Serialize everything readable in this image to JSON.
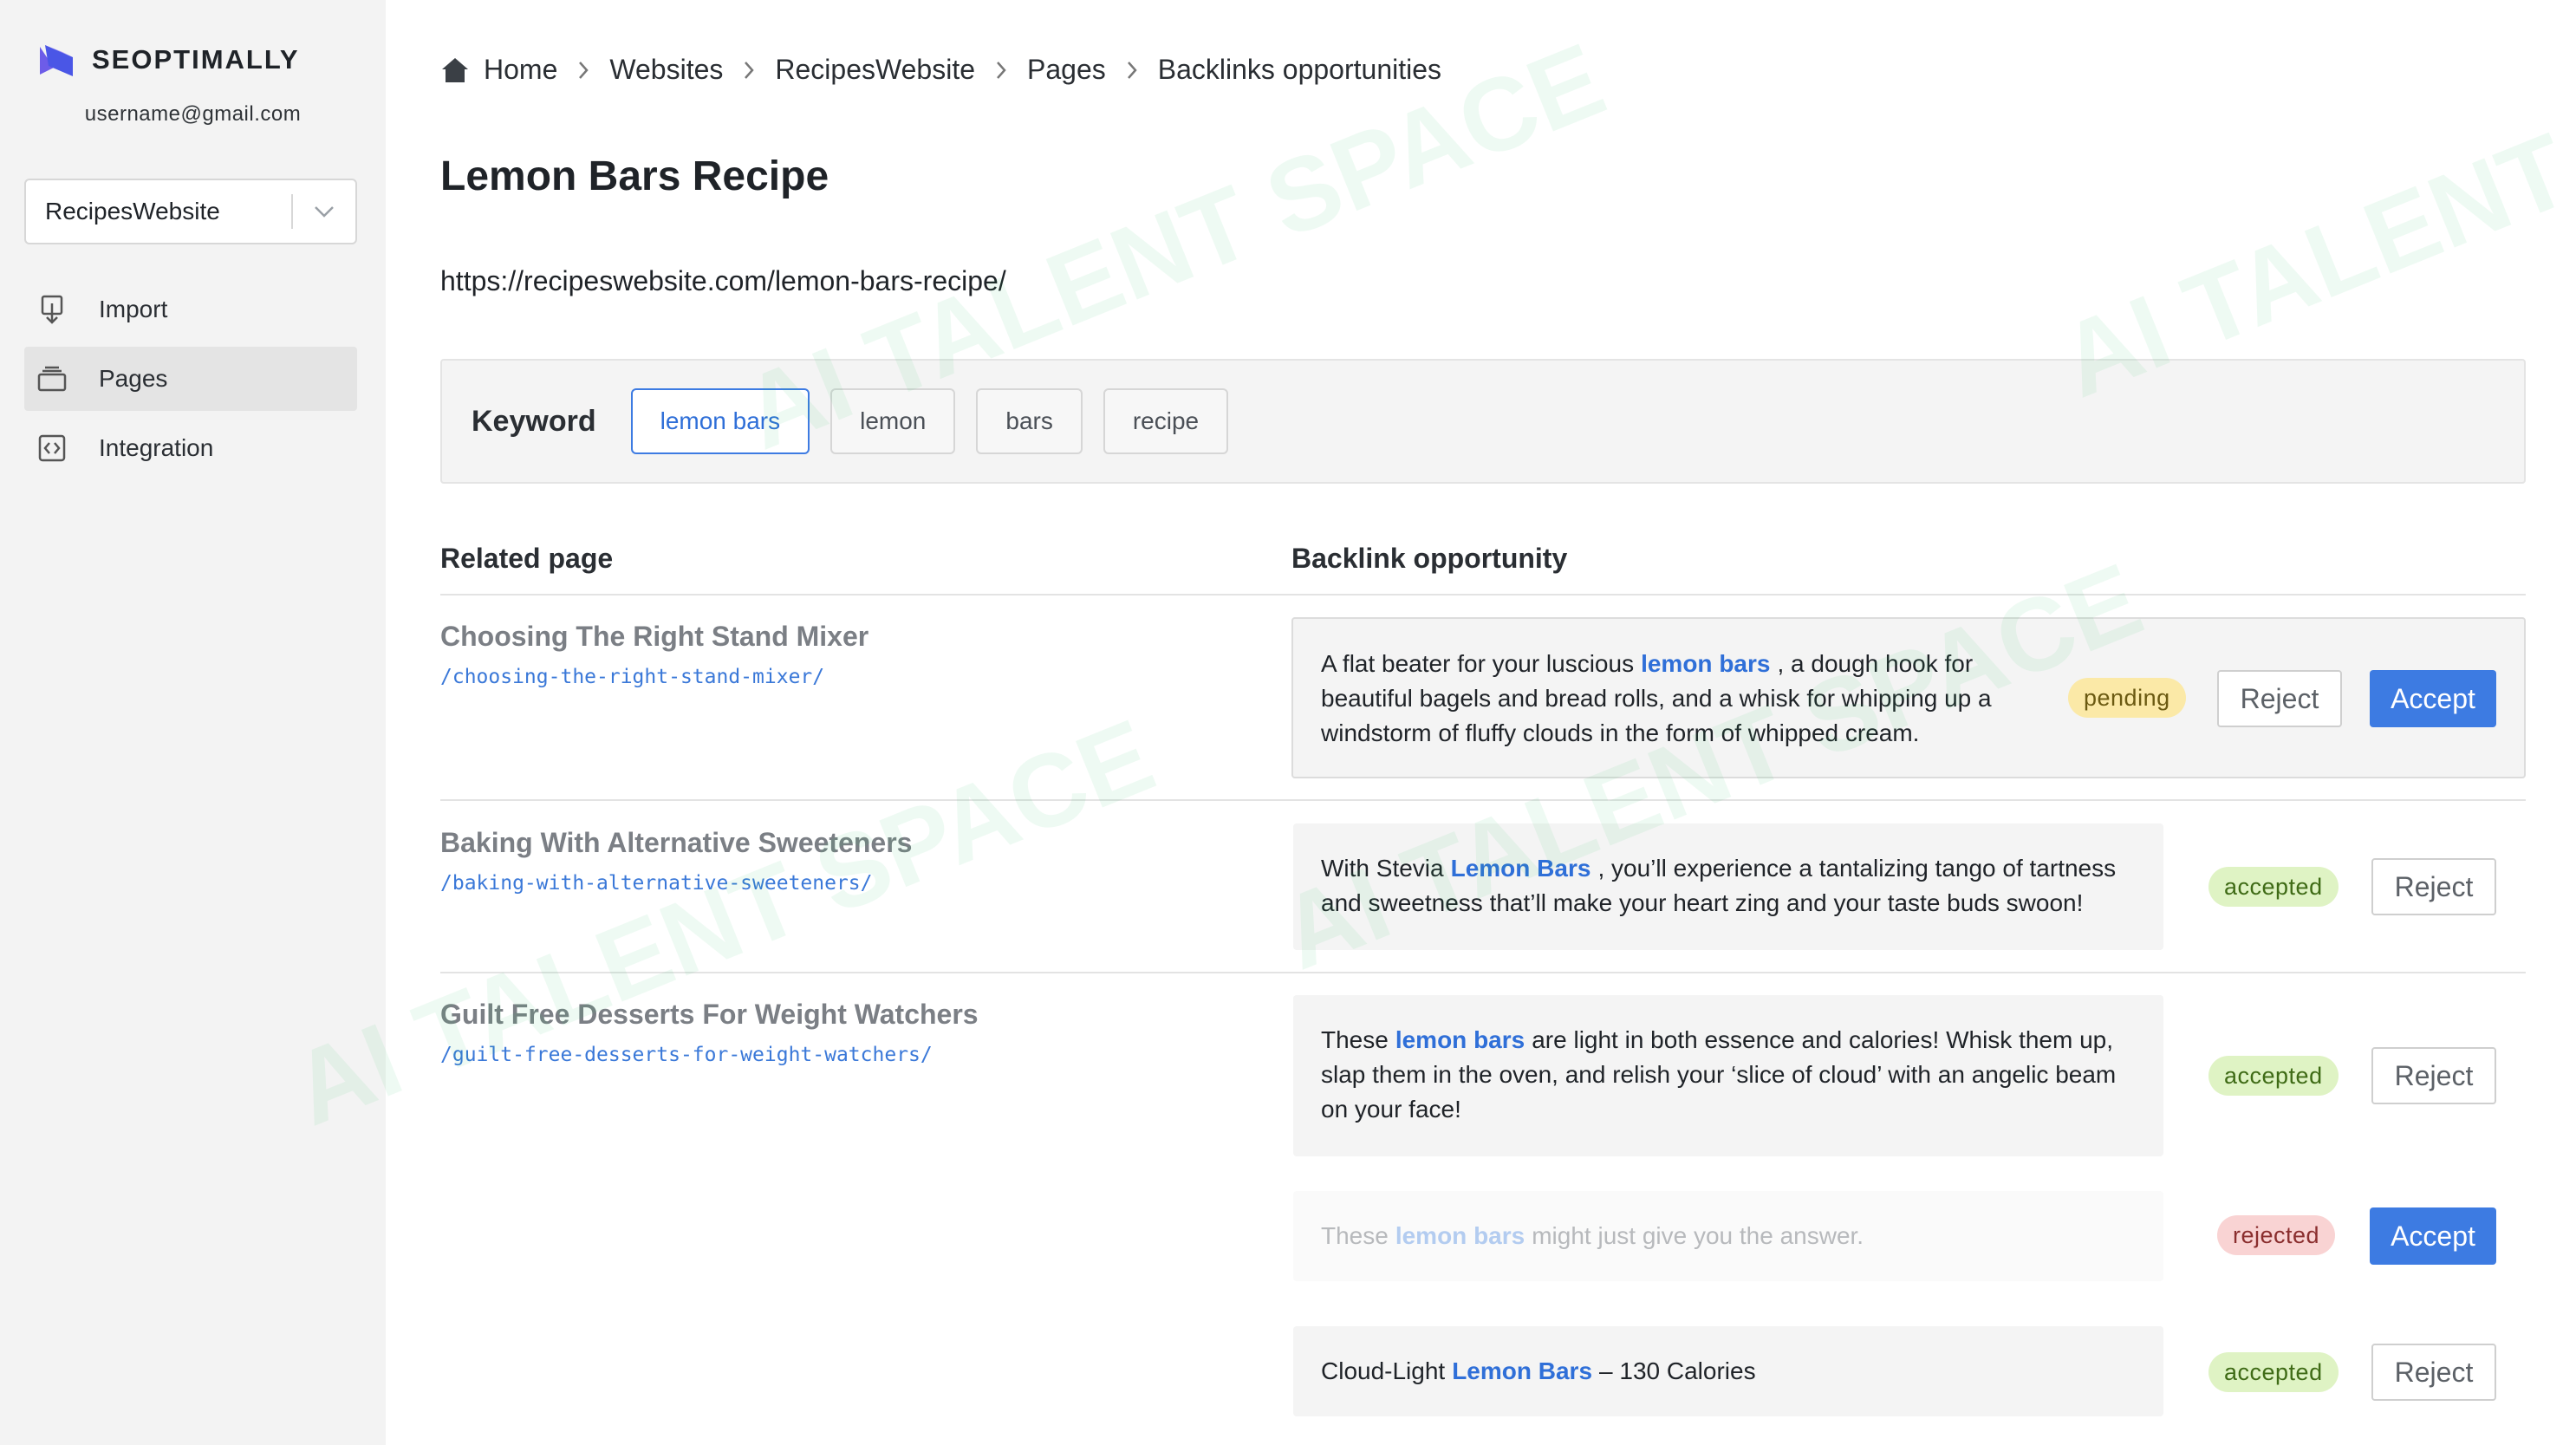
{
  "sidebar": {
    "brand": "SEOPTIMALLY",
    "user_email": "username@gmail.com",
    "site_select": {
      "value": "RecipesWebsite"
    },
    "items": [
      {
        "label": "Import",
        "icon": "import-icon",
        "active": false
      },
      {
        "label": "Pages",
        "icon": "pages-icon",
        "active": true
      },
      {
        "label": "Integration",
        "icon": "integration-icon",
        "active": false
      }
    ]
  },
  "breadcrumb": [
    "Home",
    "Websites",
    "RecipesWebsite",
    "Pages",
    "Backlinks opportunities"
  ],
  "page": {
    "title": "Lemon Bars Recipe",
    "url": "https://recipeswebsite.com/lemon-bars-recipe/"
  },
  "keywords": {
    "label": "Keyword",
    "chips": [
      "lemon bars",
      "lemon",
      "bars",
      "recipe"
    ],
    "selected": "lemon bars"
  },
  "columns": {
    "related": "Related page",
    "opportunity": "Backlink opportunity"
  },
  "related_pages": [
    {
      "title": "Choosing The Right Stand Mixer",
      "path": "/choosing-the-right-stand-mixer/"
    },
    {
      "title": "Baking With Alternative Sweeteners",
      "path": "/baking-with-alternative-sweeteners/"
    },
    {
      "title": "Guilt Free Desserts For Weight Watchers",
      "path": "/guilt-free-desserts-for-weight-watchers/"
    }
  ],
  "opportunities": [
    {
      "lines": [
        {
          "pre": "A flat beater for your luscious",
          "kw": "lemon bars",
          "post": ", a dough hook for"
        },
        {
          "pre": "beautiful bagels and bread rolls, and a whisk for whipping up a"
        },
        {
          "pre": "windstorm of fluffy clouds in the form of whipped cream."
        }
      ],
      "status": "pending",
      "reject_label": "Reject",
      "accept_label": "Accept"
    },
    {
      "lines": [
        {
          "pre": "With Stevia",
          "kw": "Lemon Bars",
          "post": ", you’ll experience a tantalizing tango of tartness"
        },
        {
          "pre": "and sweetness that’ll make your heart zing and your taste buds swoon!"
        }
      ],
      "status": "accepted",
      "reject_label": "Reject"
    },
    {
      "lines": [
        {
          "pre": "These",
          "kw": "lemon bars",
          "post": "are light in both essence and calories! Whisk them up,"
        },
        {
          "pre": "slap them in the oven, and relish your ‘slice of cloud’ with an angelic beam"
        },
        {
          "pre": "on your face!"
        }
      ],
      "status": "accepted",
      "reject_label": "Reject"
    },
    {
      "lines": [
        {
          "pre": "These",
          "kw": "lemon bars",
          "post": "might just give you the answer."
        }
      ],
      "status": "rejected",
      "accept_label": "Accept"
    },
    {
      "lines": [
        {
          "pre": "Cloud-Light",
          "kw": "Lemon Bars",
          "post": "– 130 Calories"
        }
      ],
      "status": "accepted",
      "reject_label": "Reject"
    }
  ],
  "watermark_text": "AI TALENT SPACE",
  "colors": {
    "accent": "#3d7be2",
    "sidebar_bg": "#f3f3f3",
    "pending": "#fbe9a7",
    "accepted": "#dff3c4",
    "rejected": "#f9d3d3",
    "watermark": "#22c55e"
  }
}
